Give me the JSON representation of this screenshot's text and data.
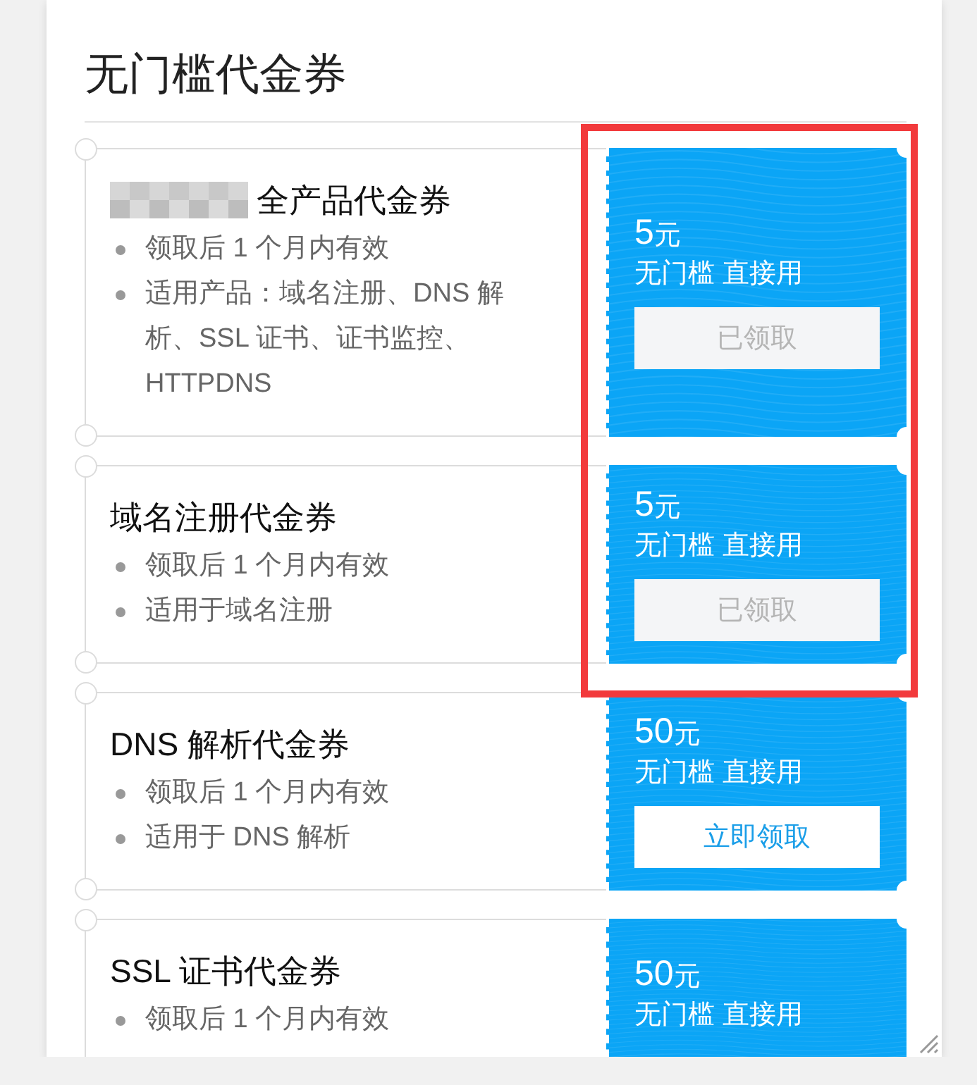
{
  "title": "无门槛代金券",
  "coupons": [
    {
      "redacted": true,
      "name": "全产品代金券",
      "terms": [
        "领取后 1 个月内有效",
        "适用产品：域名注册、DNS 解析、SSL 证书、证书监控、HTTPDNS"
      ],
      "amount": "5",
      "unit": "元",
      "condition": "无门槛 直接用",
      "button": {
        "label": "已领取",
        "claimed": true
      },
      "highlighted": true
    },
    {
      "redacted": false,
      "name": "域名注册代金券",
      "terms": [
        "领取后 1 个月内有效",
        "适用于域名注册"
      ],
      "amount": "5",
      "unit": "元",
      "condition": "无门槛 直接用",
      "button": {
        "label": "已领取",
        "claimed": true
      },
      "highlighted": true
    },
    {
      "redacted": false,
      "name": "DNS 解析代金券",
      "terms": [
        "领取后 1 个月内有效",
        "适用于 DNS 解析"
      ],
      "amount": "50",
      "unit": "元",
      "condition": "无门槛 直接用",
      "button": {
        "label": "立即领取",
        "claimed": false
      },
      "highlighted": false
    },
    {
      "redacted": false,
      "name": "SSL 证书代金券",
      "terms": [
        "领取后 1 个月内有效"
      ],
      "amount": "50",
      "unit": "元",
      "condition": "无门槛 直接用",
      "highlighted": false
    }
  ]
}
